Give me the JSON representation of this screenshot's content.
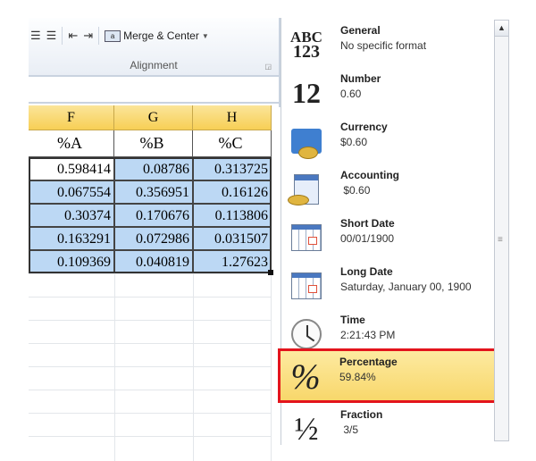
{
  "ribbon": {
    "merge_label": "Merge & Center",
    "group_label": "Alignment"
  },
  "sheet": {
    "columns": [
      "F",
      "G",
      "H"
    ],
    "headers": [
      "%A",
      "%B",
      "%C"
    ],
    "rows": [
      [
        "0.598414",
        "0.08786",
        "0.313725"
      ],
      [
        "0.067554",
        "0.356951",
        "0.16126"
      ],
      [
        "0.30374",
        "0.170676",
        "0.113806"
      ],
      [
        "0.163291",
        "0.072986",
        "0.031507"
      ],
      [
        "0.109369",
        "0.040819",
        "1.27623"
      ]
    ]
  },
  "formats": [
    {
      "title": "General",
      "sample": "No specific format",
      "icon": "abc-123-icon"
    },
    {
      "title": "Number",
      "sample": "0.60",
      "icon": "number-12-icon"
    },
    {
      "title": "Currency",
      "sample": "$0.60",
      "icon": "currency-icon"
    },
    {
      "title": "Accounting",
      "sample": " $0.60",
      "icon": "accounting-icon"
    },
    {
      "title": "Short Date",
      "sample": "00/01/1900",
      "icon": "calendar-icon"
    },
    {
      "title": "Long Date",
      "sample": "Saturday, January 00, 1900",
      "icon": "calendar-icon"
    },
    {
      "title": "Time",
      "sample": "2:21:43 PM",
      "icon": "clock-icon"
    },
    {
      "title": "Percentage",
      "sample": "59.84%",
      "icon": "percent-icon"
    },
    {
      "title": "Fraction",
      "sample": " 3/5",
      "icon": "fraction-icon"
    }
  ],
  "icon_glyphs": {
    "general_top": "ABC",
    "general_bottom": "123",
    "number": "12",
    "percent": "%",
    "fraction": "½"
  },
  "colors": {
    "highlight": "#f8d76b",
    "callout": "#e3141c",
    "selection": "#bcd8f4"
  }
}
